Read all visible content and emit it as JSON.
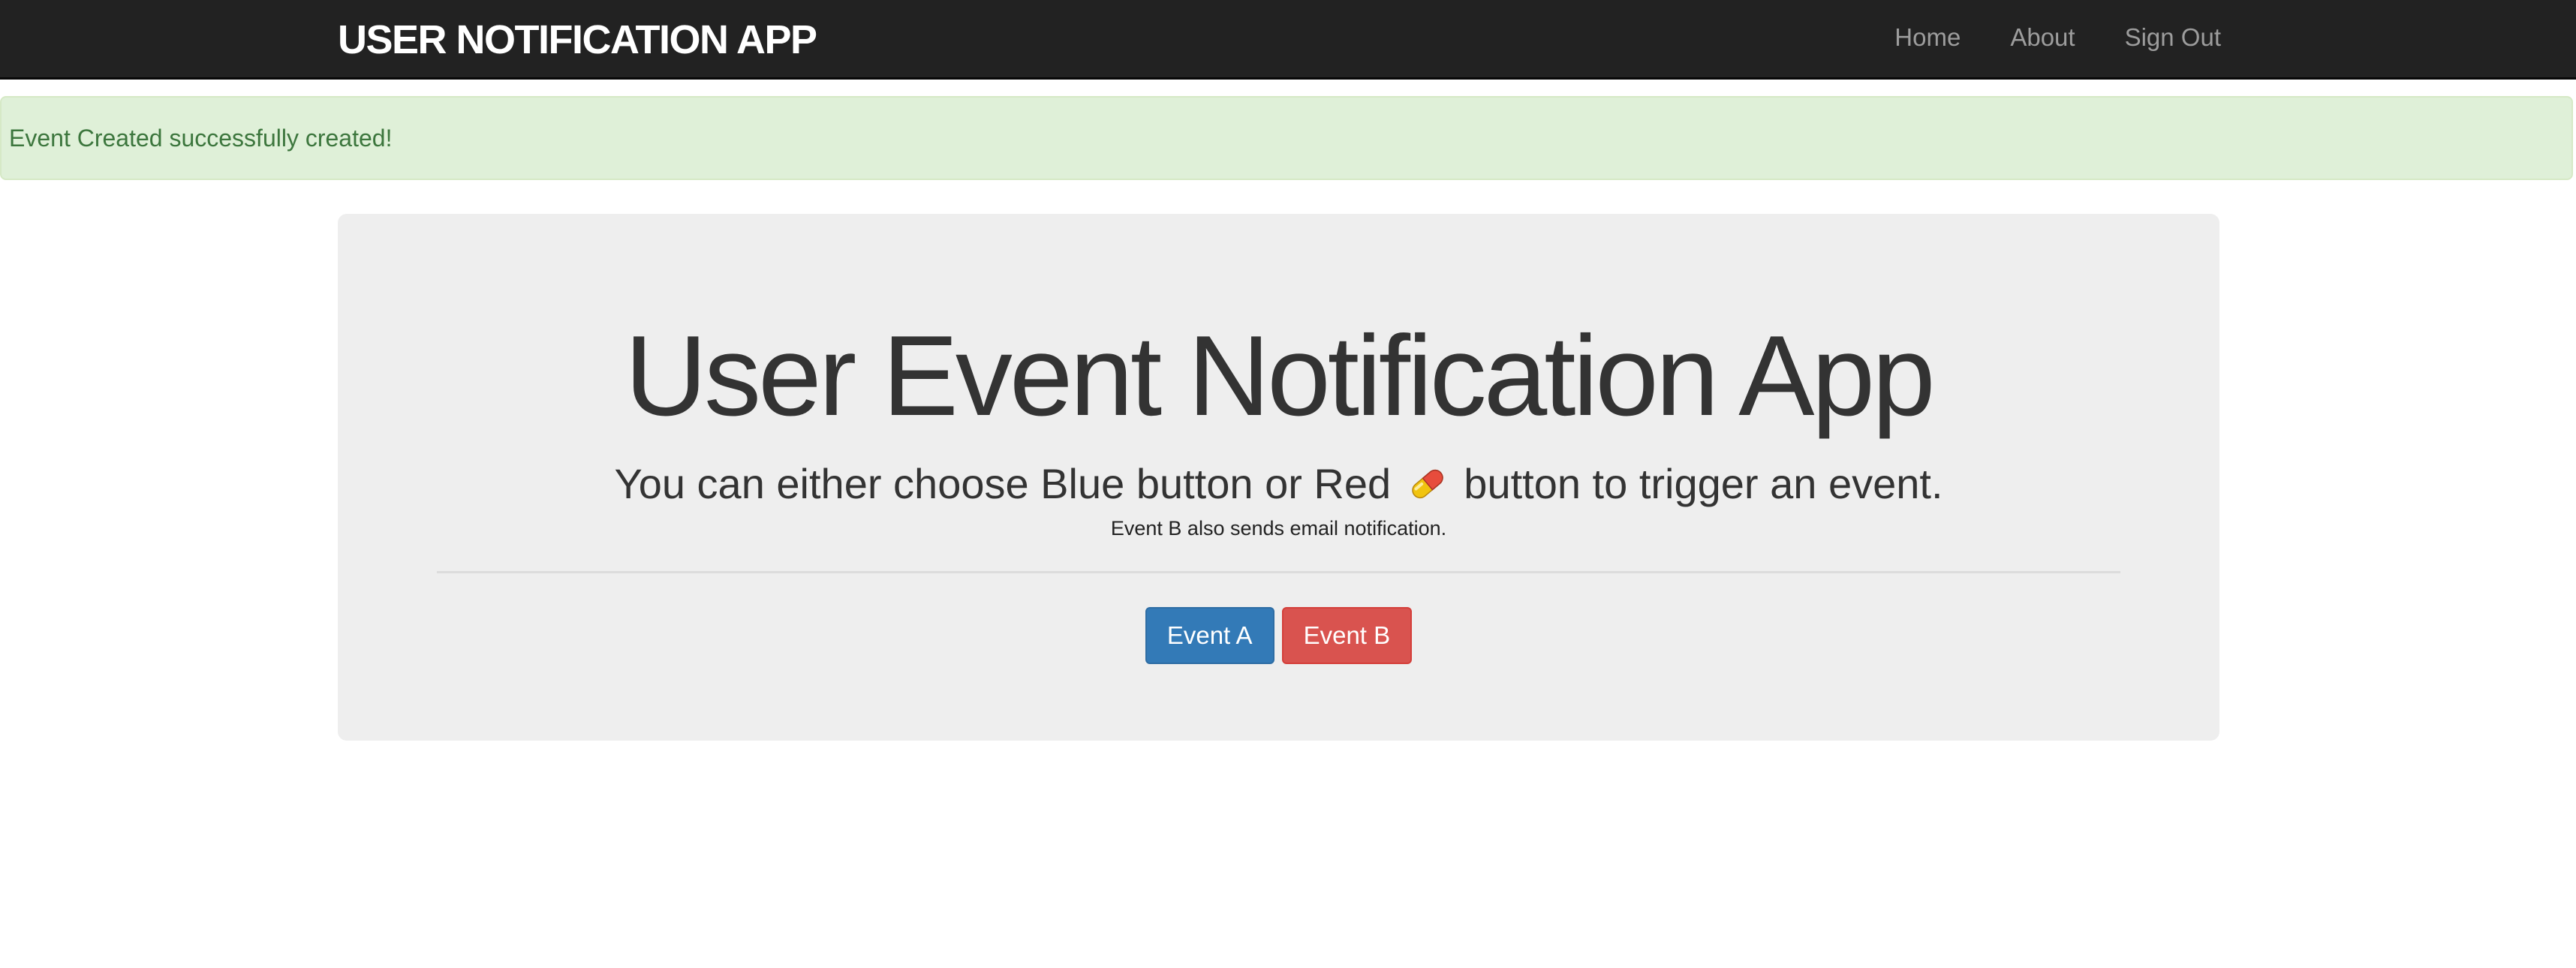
{
  "navbar": {
    "brand": "USER NOTIFICATION APP",
    "links": [
      {
        "label": "Home"
      },
      {
        "label": "About"
      },
      {
        "label": "Sign Out"
      }
    ]
  },
  "alert": {
    "message": "Event Created successfully created!"
  },
  "jumbotron": {
    "title": "User Event Notification App",
    "subtitle_before": "You can either choose Blue button or Red",
    "subtitle_icon": "pill-icon",
    "subtitle_after": "button to trigger an event.",
    "note": "Event B also sends email notification."
  },
  "actions": {
    "event_a_label": "Event A",
    "event_b_label": "Event B"
  },
  "colors": {
    "navbar_bg": "#222222",
    "alert_bg": "#dff0d8",
    "alert_text": "#3c763d",
    "jumbotron_bg": "#eeeeee",
    "primary": "#337ab7",
    "danger": "#d9534f"
  }
}
